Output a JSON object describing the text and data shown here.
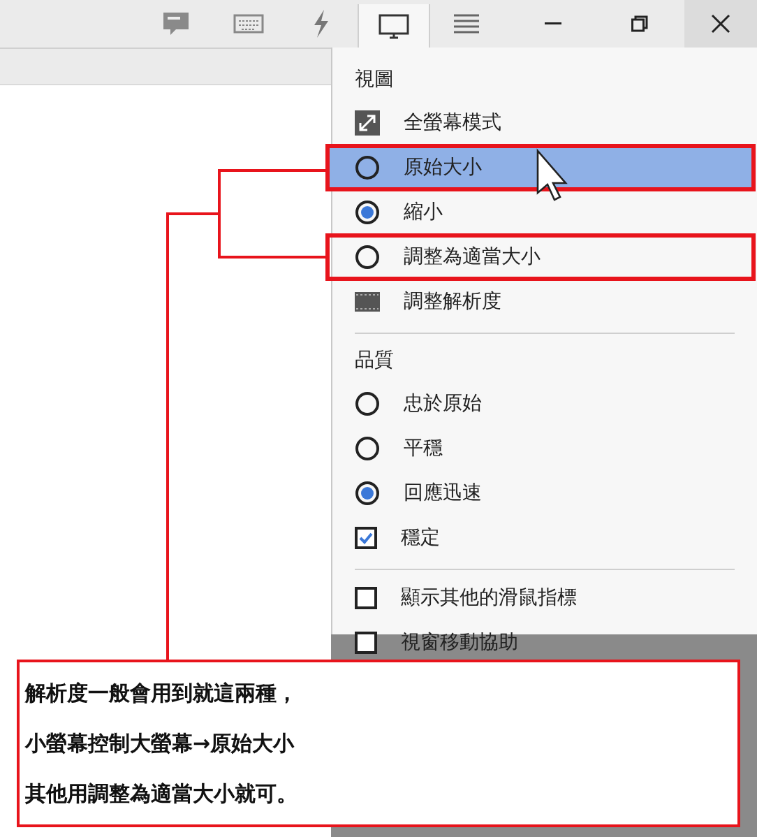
{
  "toolbar": {
    "tabs": [
      {
        "kind": "chat",
        "selected": false
      },
      {
        "kind": "keyboard",
        "selected": false
      },
      {
        "kind": "lightning",
        "selected": false
      },
      {
        "kind": "monitor",
        "selected": true
      },
      {
        "kind": "menu",
        "selected": false
      }
    ]
  },
  "menu": {
    "sections": [
      {
        "title": "視圖",
        "items": [
          {
            "kind": "fullscreen",
            "label": "全螢幕模式",
            "highlighted": false,
            "annotated": false
          },
          {
            "kind": "radio",
            "label": "原始大小",
            "selected": false,
            "highlighted": true,
            "annotated": true
          },
          {
            "kind": "radio",
            "label": "縮小",
            "selected": true,
            "highlighted": false,
            "annotated": false
          },
          {
            "kind": "radio",
            "label": "調整為適當大小",
            "selected": false,
            "highlighted": false,
            "annotated": true
          },
          {
            "kind": "resolution",
            "label": "調整解析度",
            "highlighted": false,
            "annotated": false
          }
        ]
      },
      {
        "title": "品質",
        "items": [
          {
            "kind": "radio",
            "label": "忠於原始",
            "selected": false,
            "highlighted": false,
            "annotated": false
          },
          {
            "kind": "radio",
            "label": "平穩",
            "selected": false,
            "highlighted": false,
            "annotated": false
          },
          {
            "kind": "radio",
            "label": "回應迅速",
            "selected": true,
            "highlighted": false,
            "annotated": false
          },
          {
            "kind": "checkbox",
            "label": "穩定",
            "checked": true,
            "highlighted": false,
            "annotated": false
          }
        ]
      },
      {
        "items": [
          {
            "kind": "checkbox",
            "label": "顯示其他的滑鼠指標",
            "checked": false,
            "highlighted": false,
            "annotated": false
          },
          {
            "kind": "checkbox",
            "label": "視窗移動協助",
            "checked": false,
            "highlighted": false,
            "annotated": false
          }
        ]
      }
    ]
  },
  "callout": {
    "lines": [
      "解析度一般會用到就這兩種，",
      "小螢幕控制大螢幕→原始大小",
      "其他用調整為適當大小就可。"
    ]
  }
}
